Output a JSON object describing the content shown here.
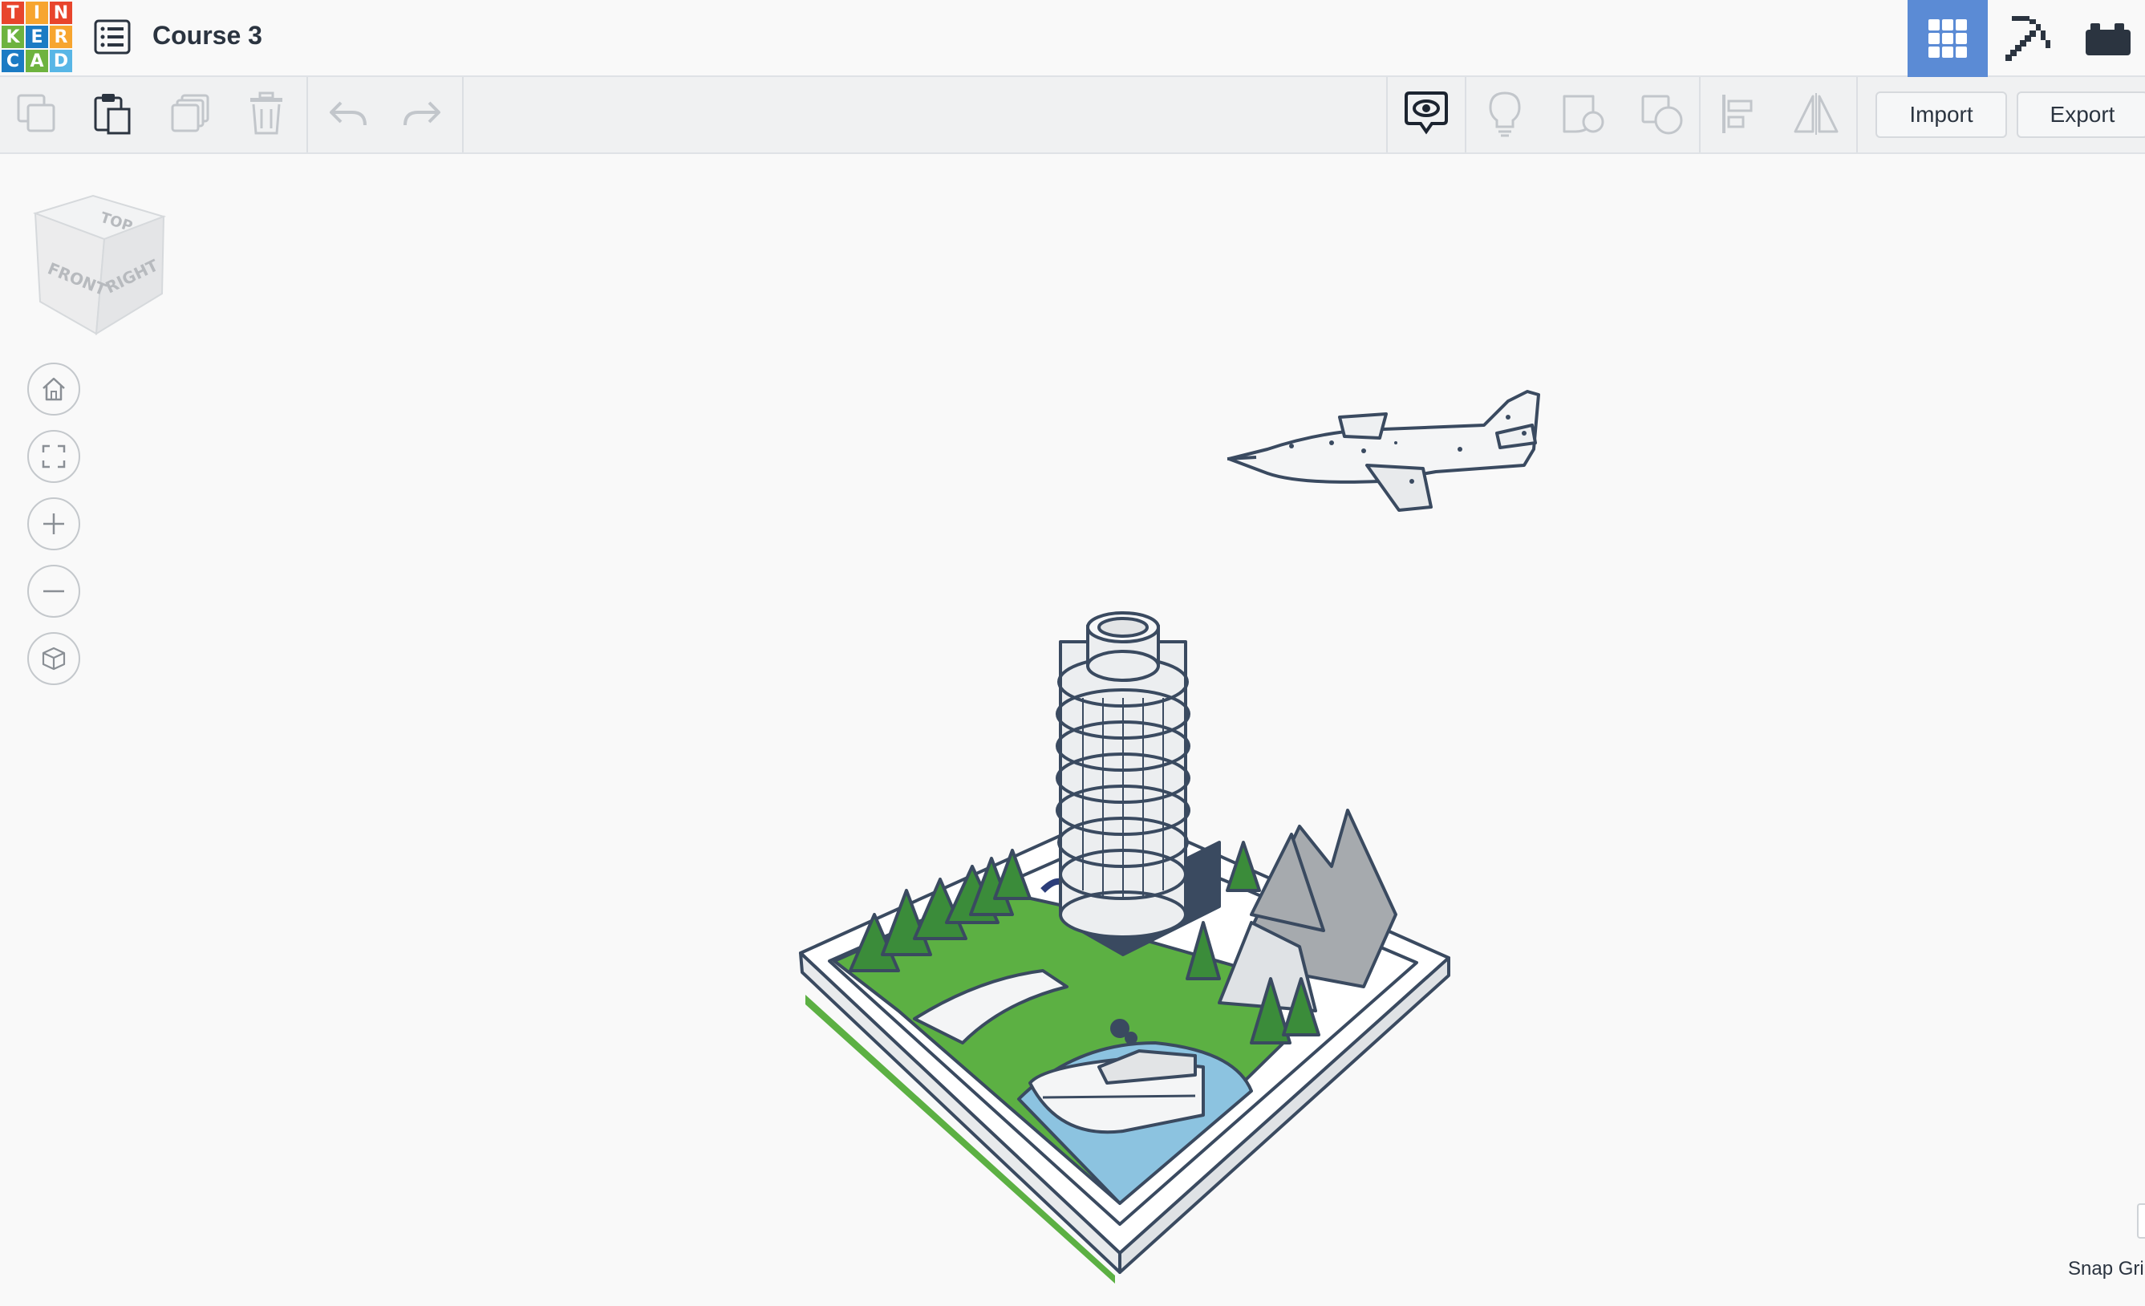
{
  "app": {
    "logo_letters": [
      "T",
      "I",
      "N",
      "K",
      "E",
      "R",
      "C",
      "A",
      "D"
    ],
    "logo_colors": [
      "#e8452c",
      "#f7a52f",
      "#e8452c",
      "#6eb33f",
      "#1b7bc4",
      "#f7a52f",
      "#1b7bc4",
      "#6eb33f",
      "#58b6e6"
    ],
    "design_title": "Course 3"
  },
  "topbar": {
    "menu_icon": "list-icon",
    "right_buttons": [
      {
        "name": "3d-design-view",
        "icon": "grid-icon",
        "active": true
      },
      {
        "name": "blocks-view",
        "icon": "pickaxe-icon",
        "active": false
      },
      {
        "name": "bricks-view",
        "icon": "brick-icon",
        "active": false
      }
    ]
  },
  "toolbar": {
    "left_tools": [
      "copy-icon",
      "paste-icon",
      "duplicate-icon",
      "delete-icon",
      "undo-icon",
      "redo-icon"
    ],
    "right_tools": [
      "show-all-icon",
      "lightbulb-icon",
      "group-icon",
      "ungroup-icon",
      "align-icon",
      "mirror-icon"
    ],
    "import_label": "Import",
    "export_label": "Export"
  },
  "viewcube": {
    "top": "TOP",
    "front": "FRONT",
    "right": "RIGHT"
  },
  "nav": [
    "home-icon",
    "fit-view-icon",
    "zoom-in-icon",
    "zoom-out-icon",
    "orthographic-icon"
  ],
  "workplane": {
    "snap_grid_label": "Snap Gri"
  },
  "colors": {
    "accent_blue": "#5b8bd5",
    "scene_outline": "#3a4a60",
    "grass": "#5cb043",
    "water": "#8cc3e0"
  }
}
